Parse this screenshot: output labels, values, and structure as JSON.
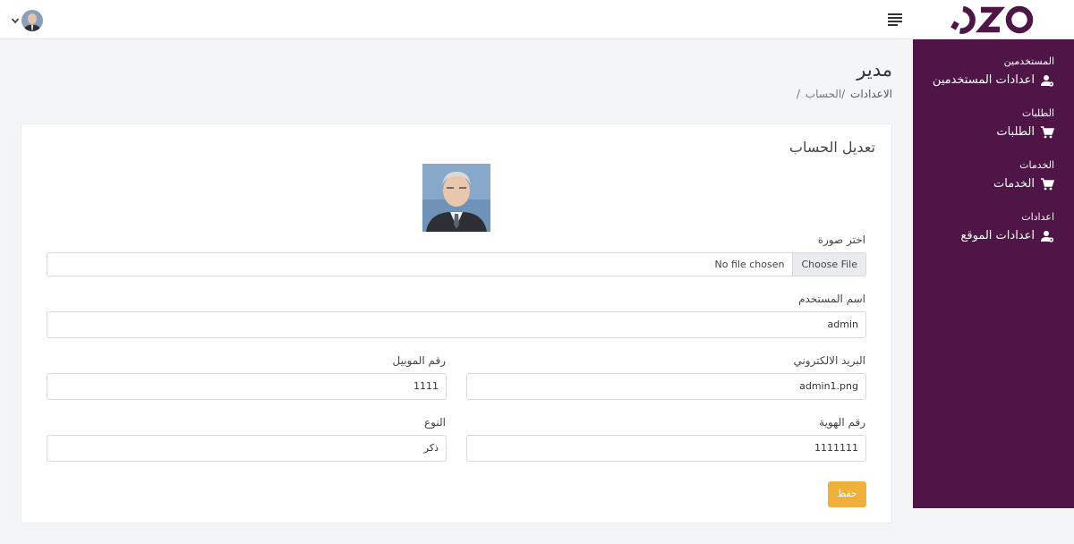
{
  "header": {
    "logo_text": "OZO",
    "menu_icon": "hamburger-icon",
    "user_avatar": "user-avatar",
    "dropdown_icon": "chevron-down-icon"
  },
  "sidebar": {
    "background": "#4e1546",
    "sections": [
      {
        "category": "المستخدمين",
        "item": "اعدادات المستخدمين",
        "icon": "users-cog-icon"
      },
      {
        "category": "الطلبات",
        "item": "الطلبات",
        "icon": "cart-icon"
      },
      {
        "category": "الخدمات",
        "item": "الخدمات",
        "icon": "cart-icon"
      },
      {
        "category": "اعدادات",
        "item": "اعدادات الموقع",
        "icon": "users-cog-icon"
      }
    ]
  },
  "page": {
    "title": "مدير",
    "breadcrumb": [
      "الاعدادات",
      "/الحساب",
      "/"
    ]
  },
  "form": {
    "title": "تعديل الحساب",
    "image_label": "اختر صورة",
    "file_button": "Choose File",
    "file_status": "No file chosen",
    "username_label": "اسم المستخدم",
    "username_value": "admin",
    "email_label": "البريد الالكتروني",
    "email_value": "admin1.png",
    "mobile_label": "رقم الموبيل",
    "mobile_value": "1111",
    "id_label": "رقم الهوية",
    "id_value": "1111111",
    "gender_label": "النوع",
    "gender_value": "ذكر",
    "save_label": "حفظ",
    "save_color": "#efb13a"
  }
}
